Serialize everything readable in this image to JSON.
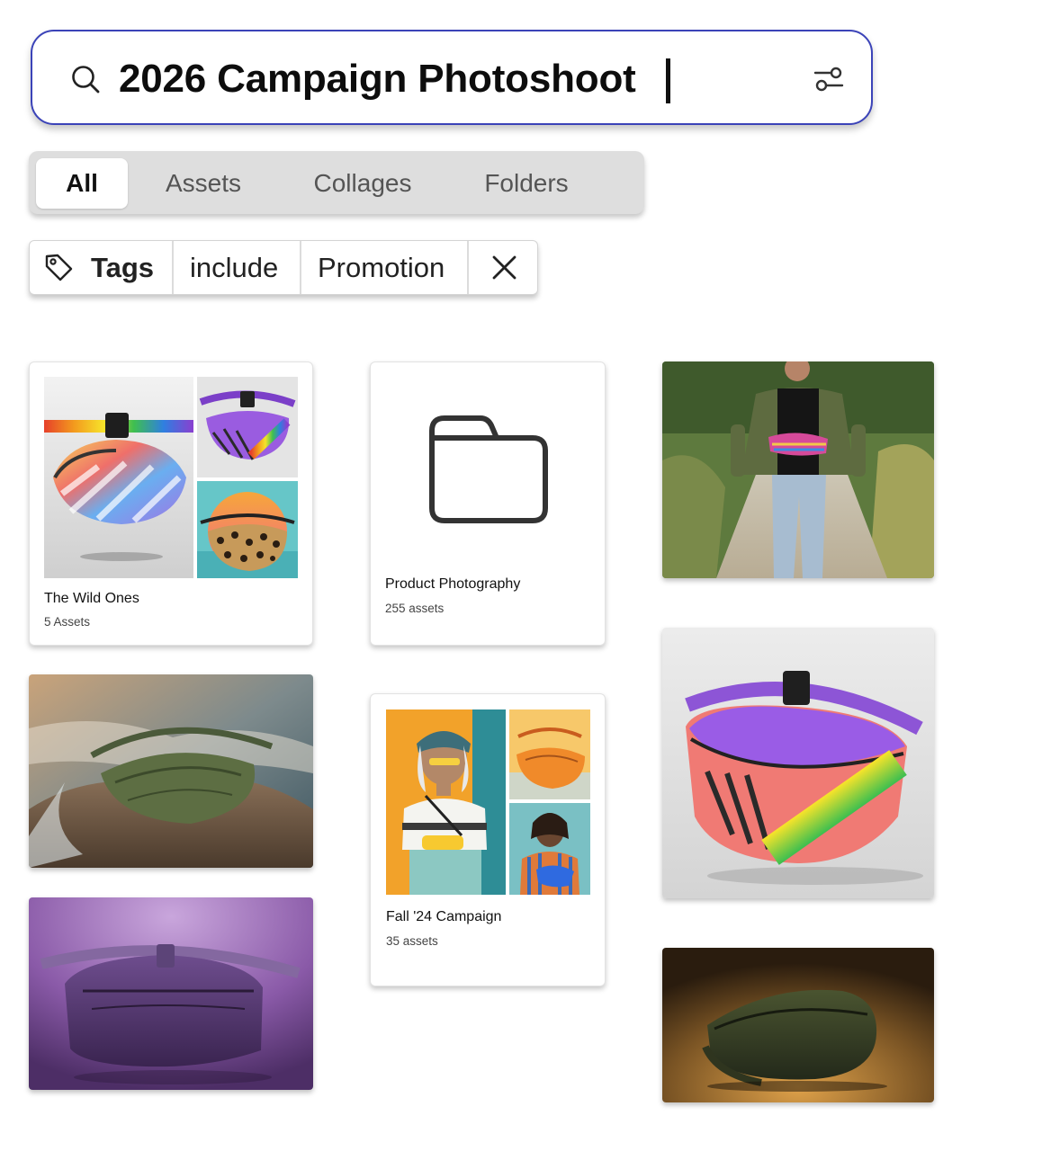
{
  "search": {
    "query": "2026 Campaign Photoshoot",
    "icon": "search-icon",
    "filter_icon": "sliders-icon",
    "accent": "#3b43b8"
  },
  "tabs": [
    {
      "label": "All",
      "active": true
    },
    {
      "label": "Assets",
      "active": false
    },
    {
      "label": "Collages",
      "active": false
    },
    {
      "label": "Folders",
      "active": false
    }
  ],
  "filter": {
    "icon": "tag-icon",
    "field": "Tags",
    "operator": "include",
    "value": "Promotion",
    "clear_icon": "close-icon"
  },
  "results": {
    "collage_wild_ones": {
      "title": "The Wild Ones",
      "subtitle": "5 Assets"
    },
    "folder_product": {
      "title": "Product Photography",
      "subtitle": "255 assets",
      "icon": "folder-icon"
    },
    "collage_fall": {
      "title": "Fall '24 Campaign",
      "subtitle": "35 assets"
    }
  }
}
